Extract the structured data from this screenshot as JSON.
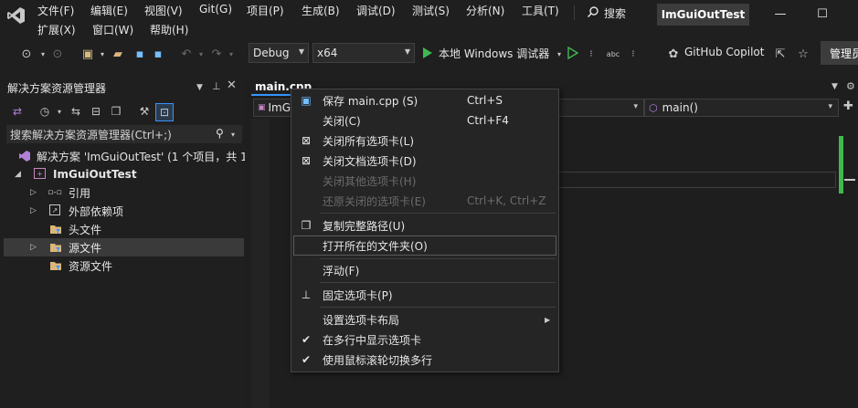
{
  "menu": {
    "row1": [
      "文件(F)",
      "编辑(E)",
      "视图(V)",
      "Git(G)",
      "项目(P)",
      "生成(B)",
      "调试(D)",
      "测试(S)",
      "分析(N)",
      "工具(T)"
    ],
    "row2": [
      "扩展(X)",
      "窗口(W)",
      "帮助(H)"
    ],
    "search": "搜索",
    "project_title": "ImGuiOutTest"
  },
  "toolbar": {
    "config": "Debug",
    "platform": "x64",
    "run_label": "本地 Windows 调试器",
    "copilot": "GitHub Copilot",
    "manage": "管理员"
  },
  "solution_explorer": {
    "title": "解决方案资源管理器",
    "search_placeholder": "搜索解决方案资源管理器(Ctrl+;)",
    "tree": [
      {
        "label": "解决方案 'ImGuiOutTest' (1 个项目，共 1",
        "icon": "solution-icon"
      },
      {
        "label": "ImGuiOutTest",
        "icon": "project-icon"
      },
      {
        "label": "引用",
        "icon": "references-icon"
      },
      {
        "label": "外部依赖项",
        "icon": "external-deps-icon"
      },
      {
        "label": "头文件",
        "icon": "filter-folder-icon"
      },
      {
        "label": "源文件",
        "icon": "filter-folder-icon"
      },
      {
        "label": "资源文件",
        "icon": "filter-folder-icon"
      }
    ]
  },
  "editor": {
    "tab": "main.cpp",
    "nav_left": "ImG",
    "nav_right": "main()"
  },
  "context_menu": [
    {
      "label": "保存 main.cpp (S)",
      "shortcut": "Ctrl+S",
      "icon": "save-icon",
      "disabled": false
    },
    {
      "label": "关闭(C)",
      "shortcut": "Ctrl+F4",
      "icon": "",
      "disabled": false
    },
    {
      "label": "关闭所有选项卡(L)",
      "shortcut": "",
      "icon": "close-all-icon",
      "disabled": false
    },
    {
      "label": "关闭文档选项卡(D)",
      "shortcut": "",
      "icon": "close-docs-icon",
      "disabled": false
    },
    {
      "label": "关闭其他选项卡(H)",
      "shortcut": "",
      "icon": "",
      "disabled": true
    },
    {
      "label": "还原关闭的选项卡(E)",
      "shortcut": "Ctrl+K, Ctrl+Z",
      "icon": "",
      "disabled": true
    },
    {
      "label": "复制完整路径(U)",
      "shortcut": "",
      "icon": "copy-icon",
      "disabled": false
    },
    {
      "label": "打开所在的文件夹(O)",
      "shortcut": "",
      "icon": "",
      "disabled": false
    },
    {
      "label": "浮动(F)",
      "shortcut": "",
      "icon": "",
      "disabled": false
    },
    {
      "label": "固定选项卡(P)",
      "shortcut": "",
      "icon": "pin-icon",
      "disabled": false
    },
    {
      "label": "设置选项卡布局",
      "shortcut": "",
      "icon": "",
      "disabled": false
    },
    {
      "label": "在多行中显示选项卡",
      "shortcut": "",
      "icon": "check-icon",
      "disabled": false
    },
    {
      "label": "使用鼠标滚轮切换多行",
      "shortcut": "",
      "icon": "check-icon",
      "disabled": false
    }
  ],
  "colors": {
    "accent": "#3794ff",
    "run_green": "#3fb950",
    "project_bg": "#3c3c3c"
  }
}
